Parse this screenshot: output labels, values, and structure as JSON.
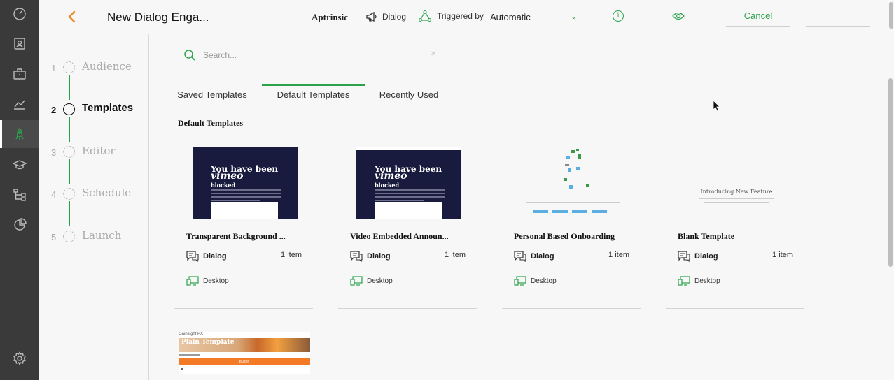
{
  "header": {
    "title": "New Dialog Enga...",
    "brand": "Aptrinsic",
    "type_label": "Dialog",
    "triggered_label": "Triggered by",
    "trigger_value": "Automatic",
    "cancel_label": "Cancel"
  },
  "rail": {
    "icons": [
      "dashboard-icon",
      "contacts-icon",
      "briefcase-icon",
      "analytics-icon",
      "engagements-icon",
      "learning-icon",
      "flows-icon",
      "reports-icon",
      "settings-icon"
    ]
  },
  "stepper": {
    "steps": [
      {
        "num": "1",
        "label": "Audience"
      },
      {
        "num": "2",
        "label": "Templates"
      },
      {
        "num": "3",
        "label": "Editor"
      },
      {
        "num": "4",
        "label": "Schedule"
      },
      {
        "num": "5",
        "label": "Launch"
      }
    ],
    "current": 2
  },
  "search": {
    "placeholder": "Search...",
    "value": ""
  },
  "tabs": [
    {
      "label": "Saved Templates"
    },
    {
      "label": "Default Templates"
    },
    {
      "label": "Recently Used"
    }
  ],
  "section_title": "Default Templates",
  "cards": [
    {
      "name": "Transparent Background ...",
      "type": "Dialog",
      "count": "1 item",
      "platform": "Desktop"
    },
    {
      "name": "Video Embedded Announ...",
      "type": "Dialog",
      "count": "1 item",
      "platform": "Desktop"
    },
    {
      "name": "Personal Based Onboarding",
      "type": "Dialog",
      "count": "1 item",
      "platform": "Desktop"
    },
    {
      "name": "Blank Template",
      "type": "Dialog",
      "count": "1 item",
      "platform": "Desktop"
    }
  ],
  "thumbs": {
    "vimeo_line1": "You have been",
    "vimeo_line2": "vimeo",
    "vimeo_line3": "blocked",
    "blank_text": "Introducing New Feature",
    "plain_brand": "Gainsight PX",
    "plain_title": "Plain Template",
    "plain_button": "Button"
  },
  "colors": {
    "accent": "#2aa24a",
    "back_arrow": "#e98a2a",
    "rail_bg": "#3a3a3a"
  }
}
